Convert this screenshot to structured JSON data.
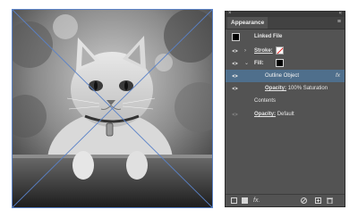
{
  "panel": {
    "close_glyph": "×",
    "collapse_glyph": "«",
    "title": "Appearance",
    "menu_glyph": "≡"
  },
  "rows": {
    "linked_file": "Linked File",
    "stroke_label": "Stroke:",
    "fill_label": "Fill:",
    "outline_object": "Outline Object",
    "outline_fx": "fx",
    "opacity_label": "Opacity:",
    "opacity_value": "100% Saturation",
    "contents": "Contents",
    "opacity2_label": "Opacity:",
    "opacity2_value": "Default"
  },
  "footer": {
    "fx": "fx."
  },
  "colors": {
    "panel_bg": "#535353",
    "highlight": "#4f6f8c",
    "selection_stroke": "#5a82c8"
  },
  "icons": [
    "eye-icon",
    "chevron-right-icon",
    "chevron-down-icon",
    "new-layer-icon",
    "circle-icon",
    "clear-icon",
    "duplicate-icon",
    "trash-icon"
  ]
}
